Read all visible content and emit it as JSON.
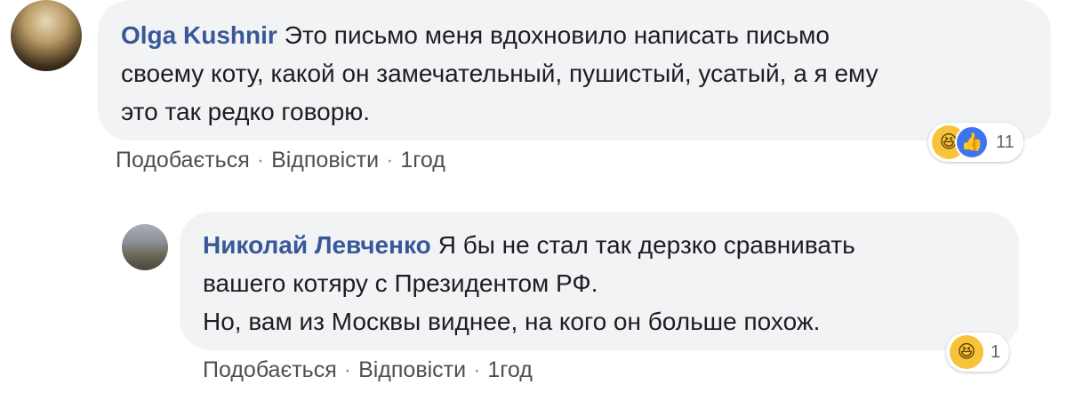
{
  "comments": [
    {
      "author": "Olga Kushnir",
      "lines": [
        "Это письмо меня вдохновило написать письмо",
        "своему коту, какой он замечательный, пушистый, усатый, а я ему",
        "это так редко говорю."
      ],
      "actions": {
        "like": "Подобається",
        "reply": "Відповісти",
        "time": "1год"
      },
      "reactions": {
        "icons": [
          "haha-icon",
          "like-icon"
        ],
        "count": "11"
      }
    },
    {
      "author": "Николай Левченко",
      "lines": [
        "Я бы не стал так дерзко сравнивать",
        "вашего котяру с Президентом РФ.",
        "Но, вам из Москвы виднее, на кого он больше похож."
      ],
      "actions": {
        "like": "Подобається",
        "reply": "Відповісти",
        "time": "1год"
      },
      "reactions": {
        "icons": [
          "haha-icon"
        ],
        "count": "1"
      }
    }
  ],
  "separator": "·",
  "colors": {
    "author": "#385898",
    "bubble": "#f2f3f5",
    "haha": "#f7c33b",
    "like": "#3b75f0"
  }
}
